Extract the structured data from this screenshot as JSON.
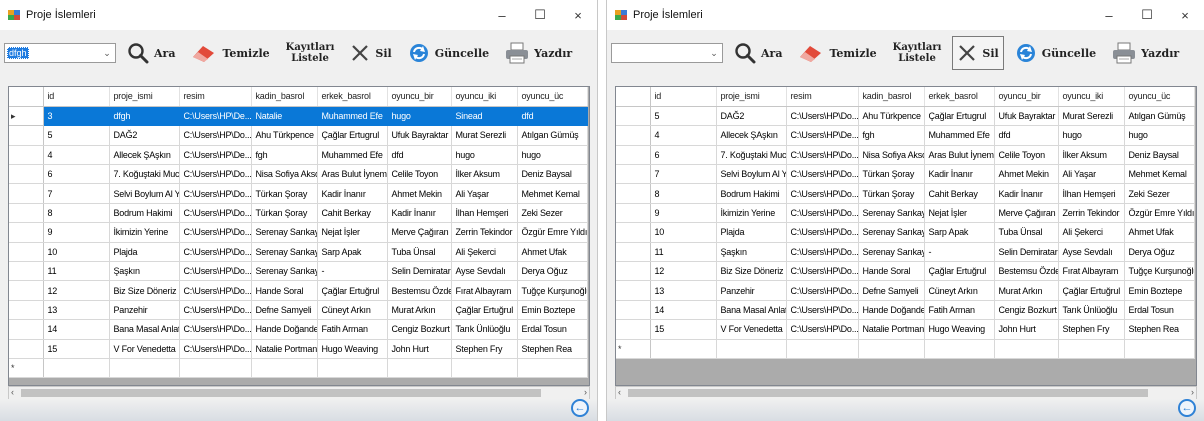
{
  "windows": [
    {
      "title": "Proje İslemleri",
      "search_value": "dfgh",
      "combo_selected": true,
      "buttons": {
        "ara": "Ara",
        "temizle": "Temizle",
        "listele_line1": "Kayıtları",
        "listele_line2": "Listele",
        "sil": "Sil",
        "guncelle": "Güncelle",
        "yazdir": "Yazdır"
      },
      "columns": [
        "id",
        "proje_ismi",
        "resim",
        "kadin_basrol",
        "erkek_basrol",
        "oyuncu_bir",
        "oyuncu_iki",
        "oyuncu_üc"
      ],
      "rows": [
        [
          "3",
          "dfgh",
          "C:\\Users\\HP\\De...",
          "Natalie",
          "Muhammed Efe",
          "hugo",
          "Sinead",
          "dfd"
        ],
        [
          "5",
          "DAĞ2",
          "C:\\Users\\HP\\Do...",
          "Ahu Türkpence",
          "Çağlar Ertugrul",
          "Ufuk Bayraktar",
          "Murat Serezli",
          "Atılgan Gümüş"
        ],
        [
          "4",
          "Allecek ŞAşkın",
          "C:\\Users\\HP\\De...",
          "fgh",
          "Muhammed Efe",
          "dfd",
          "hugo",
          "hugo"
        ],
        [
          "6",
          "7. Koğuştaki Muc...",
          "C:\\Users\\HP\\Do...",
          "Nisa Sofiya Akso...",
          "Aras Bulut İynemli",
          "Celile Toyon",
          "İlker Aksum",
          "Deniz Baysal"
        ],
        [
          "7",
          "Selvi Boylum Al Y...",
          "C:\\Users\\HP\\Do...",
          "Türkan Şoray",
          "Kadir İnanır",
          "Ahmet Mekin",
          "Ali Yaşar",
          "Mehmet Kemal"
        ],
        [
          "8",
          "Bodrum Hakimi",
          "C:\\Users\\HP\\Do...",
          "Türkan Şoray",
          "Cahit Berkay",
          "Kadir İnanır",
          "İlhan Hemşeri",
          "Zeki Sezer"
        ],
        [
          "9",
          "İkimizin Yerine",
          "C:\\Users\\HP\\Do...",
          "Serenay Sarıkaya",
          "Nejat İşler",
          "Merve Çağıran",
          "Zerrin Tekindor",
          "Özgür Emre Yıldırım"
        ],
        [
          "10",
          "Plajda",
          "C:\\Users\\HP\\Do...",
          "Serenay Sarıkaya",
          "Sarp Apak",
          "Tuba Ünsal",
          "Ali Şekerci",
          "Ahmet Ufak"
        ],
        [
          "11",
          "Şaşkın",
          "C:\\Users\\HP\\Do...",
          "Serenay Sarıkaya",
          "-",
          "Selin Demiratar",
          "Ayse Sevdalı",
          "Derya Oğuz"
        ],
        [
          "12",
          "Biz Size Döneriz",
          "C:\\Users\\HP\\Do...",
          "Hande Soral",
          "Çağlar Ertuğrul",
          "Bestemsu Özdemir",
          "Fırat Albayram",
          "Tuğçe Kurşunoğlu"
        ],
        [
          "13",
          "Panzehir",
          "C:\\Users\\HP\\Do...",
          "Defne Samyeli",
          "Cüneyt Arkın",
          "Murat Arkın",
          "Çağlar Ertuğrul",
          "Emin Boztepe"
        ],
        [
          "14",
          "Bana Masal Anlat...",
          "C:\\Users\\HP\\Do...",
          "Hande Doğandemir",
          "Fatih Arman",
          "Cengiz Bozkurt",
          "Tarık Ünlüoğlu",
          "Erdal Tosun"
        ],
        [
          "15",
          "V For Venedetta",
          "C:\\Users\\HP\\Do...",
          "Natalie Portman",
          "Hugo Weaving",
          "John Hurt",
          "Stephen Fry",
          "Stephen Rea"
        ]
      ],
      "selected_row": 0
    },
    {
      "title": "Proje İslemleri",
      "search_value": "",
      "combo_selected": false,
      "buttons": {
        "ara": "Ara",
        "temizle": "Temizle",
        "listele_line1": "Kayıtları",
        "listele_line2": "Listele",
        "sil": "Sil",
        "guncelle": "Güncelle",
        "yazdir": "Yazdır"
      },
      "columns": [
        "id",
        "proje_ismi",
        "resim",
        "kadin_basrol",
        "erkek_basrol",
        "oyuncu_bir",
        "oyuncu_iki",
        "oyuncu_üc"
      ],
      "rows": [
        [
          "5",
          "DAĞ2",
          "C:\\Users\\HP\\Do...",
          "Ahu Türkpence",
          "Çağlar Ertugrul",
          "Ufuk Bayraktar",
          "Murat Serezli",
          "Atılgan Gümüş"
        ],
        [
          "4",
          "Allecek ŞAşkın",
          "C:\\Users\\HP\\De...",
          "fgh",
          "Muhammed Efe",
          "dfd",
          "hugo",
          "hugo"
        ],
        [
          "6",
          "7. Koğuştaki Muc...",
          "C:\\Users\\HP\\Do...",
          "Nisa Sofiya Akso...",
          "Aras Bulut İynemli",
          "Celile Toyon",
          "İlker Aksum",
          "Deniz Baysal"
        ],
        [
          "7",
          "Selvi Boylum Al Y...",
          "C:\\Users\\HP\\Do...",
          "Türkan Şoray",
          "Kadir İnanır",
          "Ahmet Mekin",
          "Ali Yaşar",
          "Mehmet Kemal"
        ],
        [
          "8",
          "Bodrum Hakimi",
          "C:\\Users\\HP\\Do...",
          "Türkan Şoray",
          "Cahit Berkay",
          "Kadir İnanır",
          "İlhan Hemşeri",
          "Zeki Sezer"
        ],
        [
          "9",
          "İkimizin Yerine",
          "C:\\Users\\HP\\Do...",
          "Serenay Sarıkaya",
          "Nejat İşler",
          "Merve Çağıran",
          "Zerrin Tekindor",
          "Özgür Emre Yıldırım"
        ],
        [
          "10",
          "Plajda",
          "C:\\Users\\HP\\Do...",
          "Serenay Sarıkaya",
          "Sarp Apak",
          "Tuba Ünsal",
          "Ali Şekerci",
          "Ahmet Ufak"
        ],
        [
          "11",
          "Şaşkın",
          "C:\\Users\\HP\\Do...",
          "Serenay Sarıkaya",
          "-",
          "Selin Demiratar",
          "Ayse Sevdalı",
          "Derya Oğuz"
        ],
        [
          "12",
          "Biz Size Döneriz",
          "C:\\Users\\HP\\Do...",
          "Hande Soral",
          "Çağlar Ertuğrul",
          "Bestemsu Özdemir",
          "Fırat Albayram",
          "Tuğçe Kurşunoğlu"
        ],
        [
          "13",
          "Panzehir",
          "C:\\Users\\HP\\Do...",
          "Defne Samyeli",
          "Cüneyt Arkın",
          "Murat Arkın",
          "Çağlar Ertuğrul",
          "Emin Boztepe"
        ],
        [
          "14",
          "Bana Masal Anlat...",
          "C:\\Users\\HP\\Do...",
          "Hande Doğandemir",
          "Fatih Arman",
          "Cengiz Bozkurt",
          "Tarık Ünlüoğlu",
          "Erdal Tosun"
        ],
        [
          "15",
          "V For Venedetta",
          "C:\\Users\\HP\\Do...",
          "Natalie Portman",
          "Hugo Weaving",
          "John Hurt",
          "Stephen Fry",
          "Stephen Rea"
        ]
      ],
      "selected_row": -1
    }
  ],
  "window_controls": {
    "minimize": "–",
    "maximize": "☐",
    "close": "×"
  },
  "new_row_marker": "*",
  "current_row_marker": "▸",
  "colors": {
    "selection": "#0a78d7",
    "accent": "#2f82d6"
  }
}
